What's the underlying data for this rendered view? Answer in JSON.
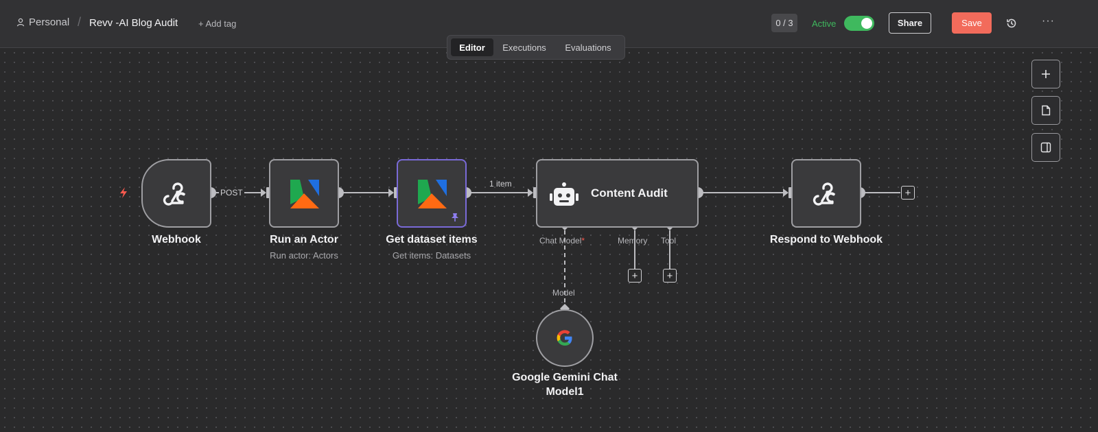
{
  "header": {
    "personal": "Personal",
    "separator": "/",
    "workflow_title": "Revv -AI Blog Audit",
    "add_tag": "+ Add tag",
    "counter": "0 / 3",
    "active_label": "Active",
    "active_state": true,
    "share_label": "Share",
    "save_label": "Save",
    "more": "···"
  },
  "tabs": [
    "Editor",
    "Executions",
    "Evaluations"
  ],
  "active_tab": "Editor",
  "nodes": {
    "webhook": {
      "label": "Webhook"
    },
    "run_actor": {
      "label": "Run an Actor",
      "subtitle": "Run actor: Actors"
    },
    "get_dataset": {
      "label": "Get dataset items",
      "subtitle": "Get items: Datasets"
    },
    "content_audit": {
      "label": "Content Audit",
      "ports": [
        "Chat Model",
        "Memory",
        "Tool"
      ]
    },
    "respond": {
      "label": "Respond to Webhook"
    },
    "gemini": {
      "label_line1": "Google Gemini Chat",
      "label_line2": "Model1",
      "port": "Model"
    }
  },
  "edges": {
    "post_label": "POST",
    "items_label": "1 item"
  },
  "side_tools": [
    "plus-icon",
    "sticky-note-icon",
    "panel-icon"
  ],
  "colors": {
    "accent_green": "#3fb95e",
    "save_red": "#f26b5b",
    "selected_purple": "#7a6ad8",
    "trigger_red": "#ff5a4e"
  }
}
